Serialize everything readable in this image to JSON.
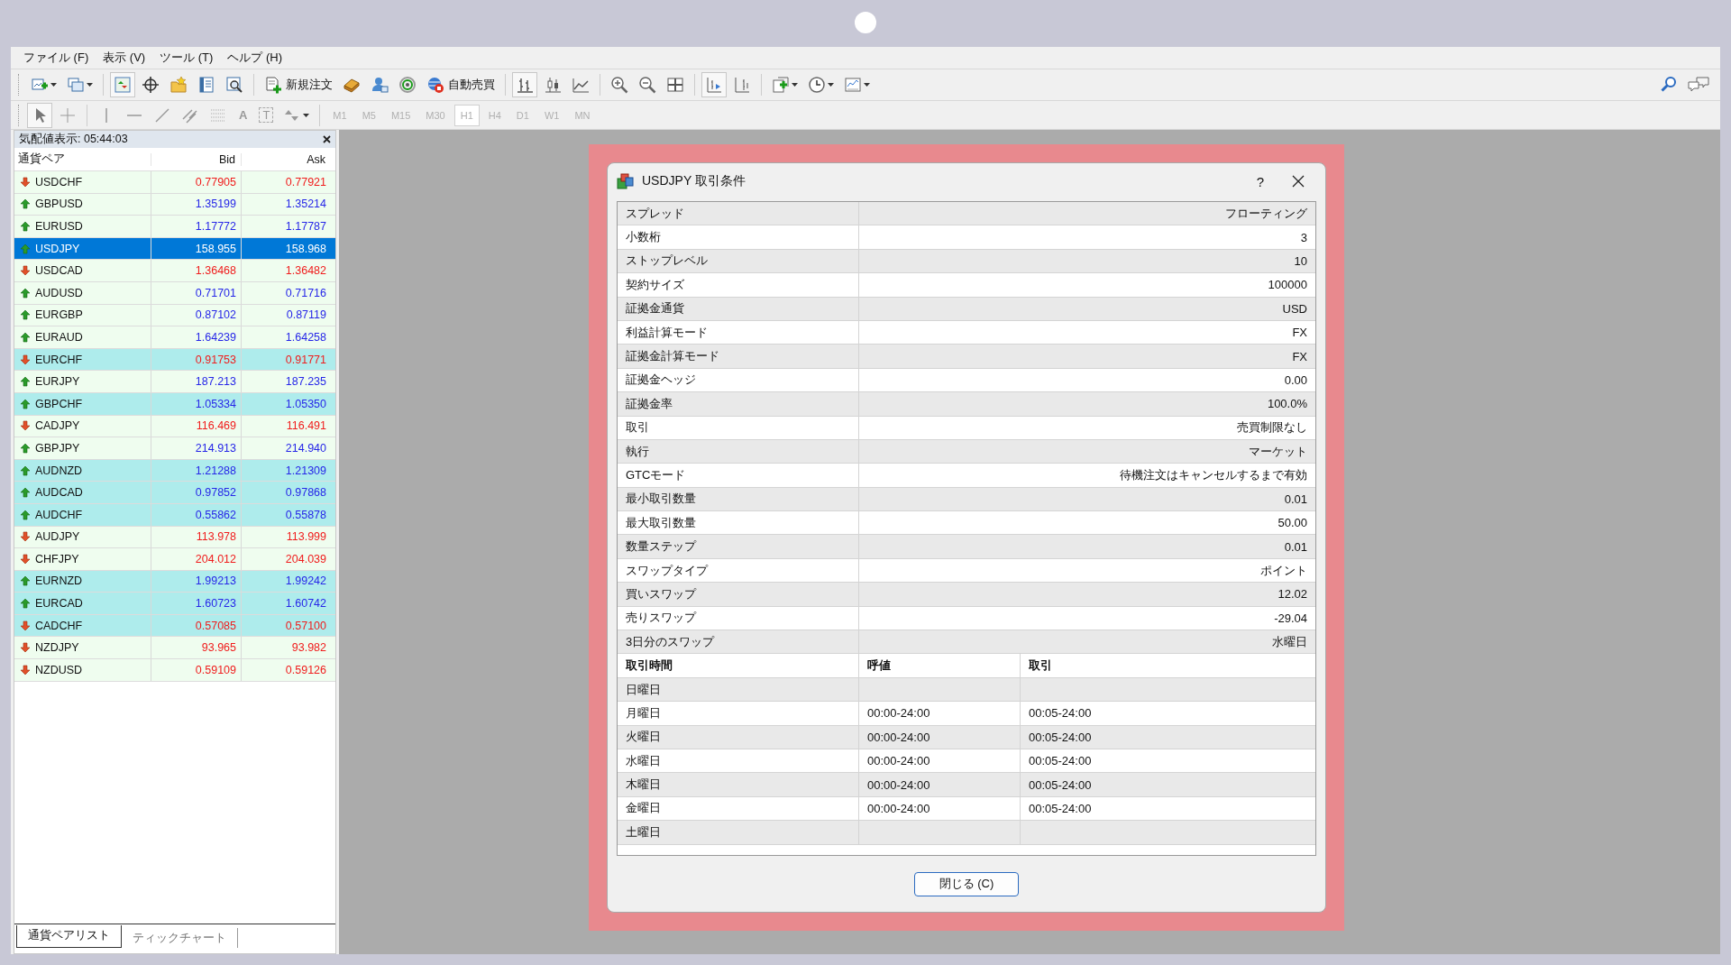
{
  "menu": [
    "ファイル (F)",
    "表示 (V)",
    "ツール (T)",
    "ヘルプ (H)"
  ],
  "toolbar": {
    "new_order": "新規注文",
    "auto_trading": "自動売買"
  },
  "drawing_toolbar": {
    "text_tool": "A",
    "label_tool": "T"
  },
  "timeframes": [
    {
      "label": "M1",
      "selected": false,
      "disabled": true
    },
    {
      "label": "M5",
      "selected": false,
      "disabled": true
    },
    {
      "label": "M15",
      "selected": false,
      "disabled": true
    },
    {
      "label": "M30",
      "selected": false,
      "disabled": true
    },
    {
      "label": "H1",
      "selected": true,
      "disabled": true
    },
    {
      "label": "H4",
      "selected": false,
      "disabled": true
    },
    {
      "label": "D1",
      "selected": false,
      "disabled": true
    },
    {
      "label": "W1",
      "selected": false,
      "disabled": true
    },
    {
      "label": "MN",
      "selected": false,
      "disabled": true
    }
  ],
  "market_watch": {
    "title": "気配値表示: 05:44:03",
    "columns": [
      "通貨ペア",
      "Bid",
      "Ask"
    ],
    "rows": [
      {
        "symbol": "USDCHF",
        "bid": "0.77905",
        "ask": "0.77921",
        "kind": "down",
        "highlighted": false,
        "selected": false
      },
      {
        "symbol": "GBPUSD",
        "bid": "1.35199",
        "ask": "1.35214",
        "kind": "up",
        "highlighted": false,
        "selected": false
      },
      {
        "symbol": "EURUSD",
        "bid": "1.17772",
        "ask": "1.17787",
        "kind": "up",
        "highlighted": false,
        "selected": false
      },
      {
        "symbol": "USDJPY",
        "bid": "158.955",
        "ask": "158.968",
        "kind": "up",
        "highlighted": false,
        "selected": true
      },
      {
        "symbol": "USDCAD",
        "bid": "1.36468",
        "ask": "1.36482",
        "kind": "down",
        "highlighted": false,
        "selected": false
      },
      {
        "symbol": "AUDUSD",
        "bid": "0.71701",
        "ask": "0.71716",
        "kind": "up",
        "highlighted": false,
        "selected": false
      },
      {
        "symbol": "EURGBP",
        "bid": "0.87102",
        "ask": "0.87119",
        "kind": "up",
        "highlighted": false,
        "selected": false
      },
      {
        "symbol": "EURAUD",
        "bid": "1.64239",
        "ask": "1.64258",
        "kind": "up",
        "highlighted": false,
        "selected": false
      },
      {
        "symbol": "EURCHF",
        "bid": "0.91753",
        "ask": "0.91771",
        "kind": "down",
        "highlighted": true,
        "selected": false
      },
      {
        "symbol": "EURJPY",
        "bid": "187.213",
        "ask": "187.235",
        "kind": "up",
        "highlighted": false,
        "selected": false
      },
      {
        "symbol": "GBPCHF",
        "bid": "1.05334",
        "ask": "1.05350",
        "kind": "up",
        "highlighted": true,
        "selected": false
      },
      {
        "symbol": "CADJPY",
        "bid": "116.469",
        "ask": "116.491",
        "kind": "down",
        "highlighted": false,
        "selected": false
      },
      {
        "symbol": "GBPJPY",
        "bid": "214.913",
        "ask": "214.940",
        "kind": "up",
        "highlighted": false,
        "selected": false
      },
      {
        "symbol": "AUDNZD",
        "bid": "1.21288",
        "ask": "1.21309",
        "kind": "up",
        "highlighted": true,
        "selected": false
      },
      {
        "symbol": "AUDCAD",
        "bid": "0.97852",
        "ask": "0.97868",
        "kind": "up",
        "highlighted": true,
        "selected": false
      },
      {
        "symbol": "AUDCHF",
        "bid": "0.55862",
        "ask": "0.55878",
        "kind": "up",
        "highlighted": true,
        "selected": false
      },
      {
        "symbol": "AUDJPY",
        "bid": "113.978",
        "ask": "113.999",
        "kind": "down",
        "highlighted": false,
        "selected": false
      },
      {
        "symbol": "CHFJPY",
        "bid": "204.012",
        "ask": "204.039",
        "kind": "down",
        "highlighted": false,
        "selected": false
      },
      {
        "symbol": "EURNZD",
        "bid": "1.99213",
        "ask": "1.99242",
        "kind": "up",
        "highlighted": true,
        "selected": false
      },
      {
        "symbol": "EURCAD",
        "bid": "1.60723",
        "ask": "1.60742",
        "kind": "up",
        "highlighted": true,
        "selected": false
      },
      {
        "symbol": "CADCHF",
        "bid": "0.57085",
        "ask": "0.57100",
        "kind": "down",
        "highlighted": true,
        "selected": false
      },
      {
        "symbol": "NZDJPY",
        "bid": "93.965",
        "ask": "93.982",
        "kind": "down",
        "highlighted": false,
        "selected": false
      },
      {
        "symbol": "NZDUSD",
        "bid": "0.59109",
        "ask": "0.59126",
        "kind": "down",
        "highlighted": false,
        "selected": false
      }
    ],
    "tabs": [
      {
        "label": "通貨ペアリスト",
        "selected": true
      },
      {
        "label": "ティックチャート",
        "selected": false
      }
    ]
  },
  "dialog": {
    "title": "USDJPY 取引条件",
    "help": "?",
    "specs": [
      {
        "label": "スプレッド",
        "value": "フローティング"
      },
      {
        "label": "小数桁",
        "value": "3"
      },
      {
        "label": "ストップレベル",
        "value": "10"
      },
      {
        "label": "契約サイズ",
        "value": "100000"
      },
      {
        "label": "証拠金通貨",
        "value": "USD"
      },
      {
        "label": "利益計算モード",
        "value": "FX"
      },
      {
        "label": "証拠金計算モード",
        "value": "FX"
      },
      {
        "label": "証拠金ヘッジ",
        "value": "0.00"
      },
      {
        "label": "証拠金率",
        "value": "100.0%"
      },
      {
        "label": "取引",
        "value": "売買制限なし"
      },
      {
        "label": "執行",
        "value": "マーケット"
      },
      {
        "label": "GTCモード",
        "value": "待機注文はキャンセルするまで有効"
      },
      {
        "label": "最小取引数量",
        "value": "0.01"
      },
      {
        "label": "最大取引数量",
        "value": "50.00"
      },
      {
        "label": "数量ステップ",
        "value": "0.01"
      },
      {
        "label": "スワップタイプ",
        "value": "ポイント"
      },
      {
        "label": "買いスワップ",
        "value": "12.02"
      },
      {
        "label": "売りスワップ",
        "value": "-29.04"
      },
      {
        "label": "3日分のスワップ",
        "value": "水曜日"
      }
    ],
    "sessions": {
      "columns": [
        "取引時間",
        "呼値",
        "取引"
      ],
      "rows": [
        {
          "day": "日曜日"
        },
        {
          "day": "月曜日",
          "quotes": "00:00-24:00",
          "trade": "00:05-24:00"
        },
        {
          "day": "火曜日",
          "quotes": "00:00-24:00",
          "trade": "00:05-24:00"
        },
        {
          "day": "水曜日",
          "quotes": "00:00-24:00",
          "trade": "00:05-24:00"
        },
        {
          "day": "木曜日",
          "quotes": "00:00-24:00",
          "trade": "00:05-24:00"
        },
        {
          "day": "金曜日",
          "quotes": "00:00-24:00",
          "trade": "00:05-24:00"
        },
        {
          "day": "土曜日"
        }
      ]
    },
    "close_button": "閉じる (C)"
  }
}
